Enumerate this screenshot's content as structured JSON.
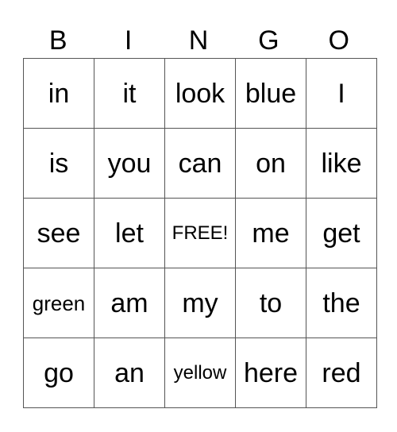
{
  "header": [
    "B",
    "I",
    "N",
    "G",
    "O"
  ],
  "rows": [
    [
      "in",
      "it",
      "look",
      "blue",
      "I"
    ],
    [
      "is",
      "you",
      "can",
      "on",
      "like"
    ],
    [
      "see",
      "let",
      "FREE!",
      "me",
      "get"
    ],
    [
      "green",
      "am",
      "my",
      "to",
      "the"
    ],
    [
      "go",
      "an",
      "yellow",
      "here",
      "red"
    ]
  ]
}
